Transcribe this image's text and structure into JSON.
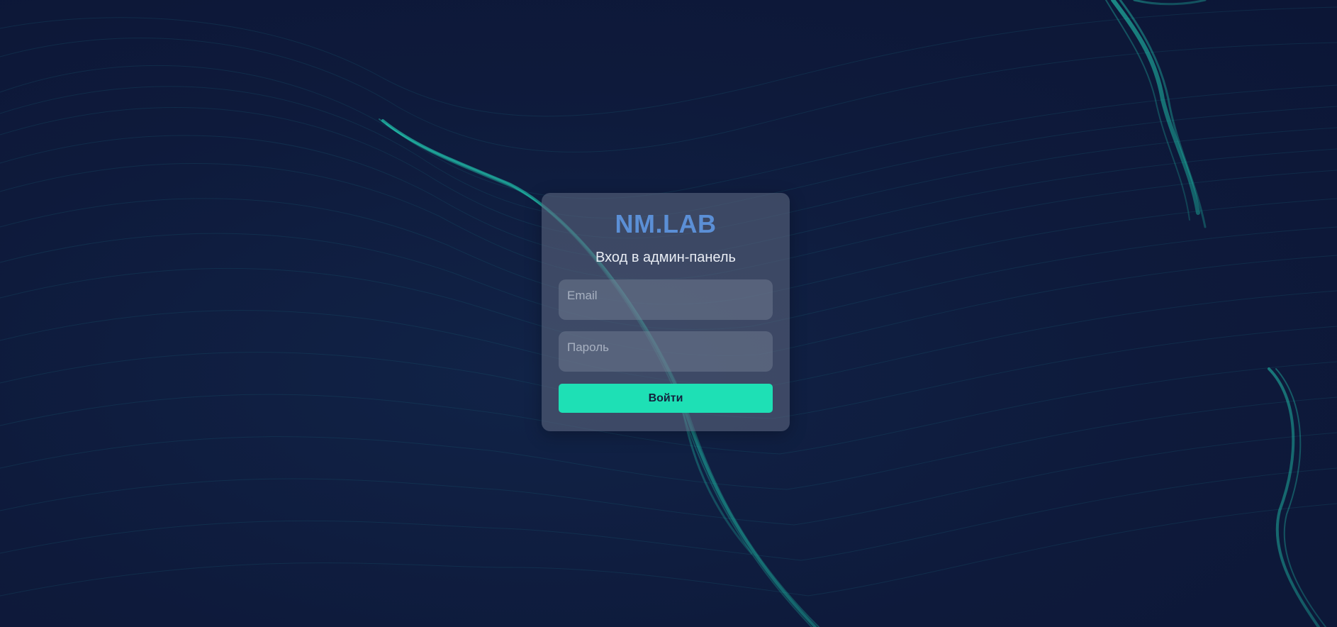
{
  "login": {
    "logo_text": "NM.LAB",
    "subtitle": "Вход в админ-панель",
    "email_placeholder": "Email",
    "email_value": "",
    "password_placeholder": "Пароль",
    "password_value": "",
    "submit_label": "Войти"
  },
  "colors": {
    "background": "#0e1a3b",
    "flow_lines": "#1fb3a3",
    "logo": "#5b8fd6",
    "submit_button": "#1ee0b5",
    "submit_text": "#14213d"
  }
}
